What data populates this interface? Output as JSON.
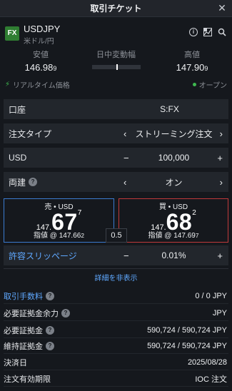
{
  "window": {
    "title": "取引チケット",
    "close_label": "✕"
  },
  "instrument": {
    "badge": "FX",
    "symbol": "USDJPY",
    "subtitle": "米ドル/円"
  },
  "stats": {
    "low_label": "安値",
    "low_value": "146.98",
    "low_small": "9",
    "range_label": "日中変動幅",
    "range_position": 0.5,
    "high_label": "高値",
    "high_value": "147.90",
    "high_small": "9"
  },
  "realtime": {
    "label": "リアルタイム価格",
    "market_status": "オープン"
  },
  "account": {
    "label": "口座",
    "value": "S:FX"
  },
  "order_type": {
    "label": "注文タイプ",
    "value": "ストリーミング注文",
    "prev": "‹",
    "next": "›"
  },
  "amount": {
    "label": "USD",
    "value": "100,000",
    "minus": "−",
    "plus": "+"
  },
  "hedge": {
    "label": "両建",
    "value": "オン",
    "prev": "‹",
    "next": "›",
    "help": "?"
  },
  "sell": {
    "header": "売 • USD",
    "prefix": "147.",
    "big": "67",
    "sup": "7",
    "limit_label": "指値 @ 147.66",
    "limit_small": "2"
  },
  "buy": {
    "header": "買 • USD",
    "prefix": "147.",
    "big": "68",
    "sup": "2",
    "limit_label": "指値 @ 147.69",
    "limit_small": "7"
  },
  "spread": "0.5",
  "slippage": {
    "label": "許容スリッページ",
    "value": "0.01%",
    "minus": "−",
    "plus": "+"
  },
  "details_toggle": "詳細を非表示",
  "details": [
    {
      "label": "取引手数料",
      "value": "0 / 0 JPY",
      "help": true,
      "link": true
    },
    {
      "label": "必要証拠金余力",
      "value": "JPY",
      "help": true,
      "link": false
    },
    {
      "label": "必要証拠金",
      "value": "590,724 / 590,724 JPY",
      "help": true,
      "link": false
    },
    {
      "label": "維持証拠金",
      "value": "590,724 / 590,724 JPY",
      "help": true,
      "link": false
    },
    {
      "label": "決済日",
      "value": "2025/08/28",
      "help": false,
      "link": false
    },
    {
      "label": "注文有効期限",
      "value": "IOC 注文",
      "help": false,
      "link": false
    }
  ],
  "colors": {
    "accent": "#5fa8ff",
    "sell_border": "#3b7bd0",
    "buy_border": "#c0393b",
    "fx_badge": "#2f7d32",
    "live": "#3fb950"
  }
}
